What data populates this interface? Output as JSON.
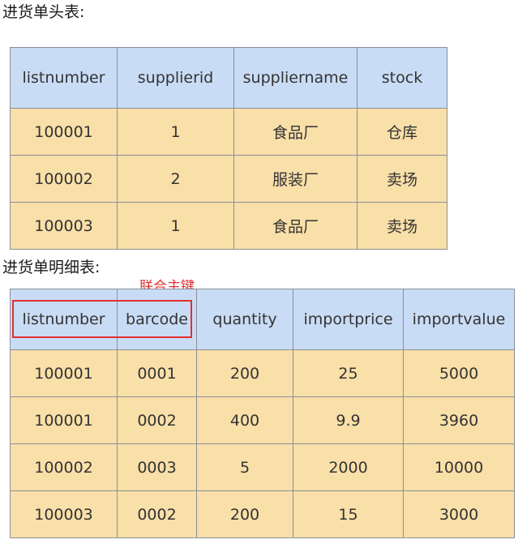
{
  "header_table": {
    "title": "进货单头表:",
    "columns": [
      "listnumber",
      "supplierid",
      "suppliername",
      "stock"
    ],
    "rows": [
      [
        "100001",
        "1",
        "食品厂",
        "仓库"
      ],
      [
        "100002",
        "2",
        "服装厂",
        "卖场"
      ],
      [
        "100003",
        "1",
        "食品厂",
        "卖场"
      ]
    ]
  },
  "detail_table": {
    "title": "进货单明细表:",
    "annotation": "联合主键",
    "columns": [
      "listnumber",
      "barcode",
      "quantity",
      "importprice",
      "importvalue"
    ],
    "rows": [
      [
        "100001",
        "0001",
        "200",
        "25",
        "5000"
      ],
      [
        "100001",
        "0002",
        "400",
        "9.9",
        "3960"
      ],
      [
        "100002",
        "0003",
        "5",
        "2000",
        "10000"
      ],
      [
        "100003",
        "0002",
        "200",
        "15",
        "3000"
      ]
    ]
  },
  "colors": {
    "header_bg": "#c9dcf5",
    "cell_bg": "#f9dfa8",
    "border": "#8a8f99",
    "highlight": "#e03030"
  }
}
